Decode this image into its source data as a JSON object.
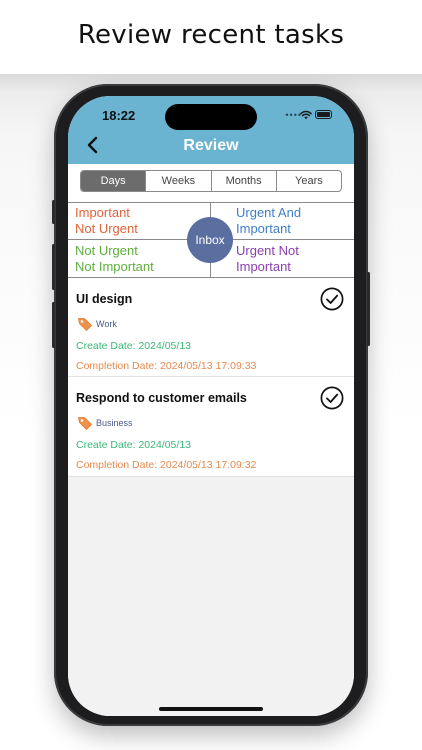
{
  "headline": "Review recent tasks",
  "status": {
    "time": "18:22"
  },
  "nav": {
    "title": "Review"
  },
  "segments": [
    {
      "label": "Days",
      "selected": true
    },
    {
      "label": "Weeks",
      "selected": false
    },
    {
      "label": "Months",
      "selected": false
    },
    {
      "label": "Years",
      "selected": false
    }
  ],
  "quadrants": {
    "top_left": {
      "line1": "Important",
      "line2": "Not Urgent",
      "color": "#e0643a"
    },
    "top_right": {
      "line1": "Urgent And",
      "line2": "Important",
      "color": "#3f7fc8"
    },
    "bottom_left": {
      "line1": "Not Urgent",
      "line2": "Not Important",
      "color": "#5fae3c"
    },
    "bottom_right": {
      "line1": "Urgent Not",
      "line2": "Important",
      "color": "#8a3fb0"
    },
    "center_label": "Inbox"
  },
  "tasks": [
    {
      "title": "UI design",
      "tag": "Work",
      "create": "Create Date: 2024/05/13",
      "complete": "Completion Date: 2024/05/13 17:09:33"
    },
    {
      "title": "Respond to customer emails",
      "tag": "Business",
      "create": "Create Date: 2024/05/13",
      "complete": "Completion Date: 2024/05/13 17:09:32"
    }
  ],
  "colors": {
    "nav_bar": "#6ab4d1",
    "create_date": "#3cb878",
    "completion_date": "#e58a4e",
    "tag_icon": "#f0924a",
    "inbox_circle": "#5b6ea0"
  },
  "icons": {
    "back": "chevron-left-icon",
    "check": "check-circle-icon",
    "tag": "tag-icon",
    "wifi": "wifi-icon",
    "battery": "battery-icon",
    "signal": "cellular-signal-icon"
  }
}
